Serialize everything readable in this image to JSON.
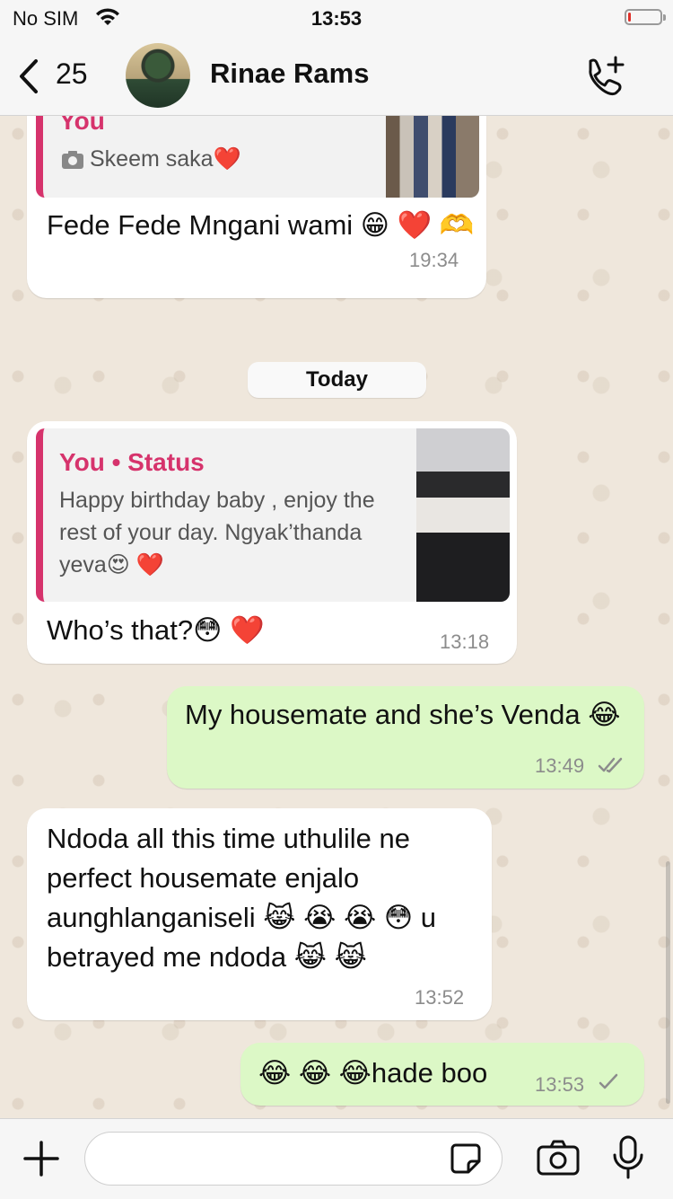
{
  "status_bar": {
    "carrier": "No SIM",
    "time": "13:53",
    "battery_level": 0.1,
    "battery_color": "#e0302a"
  },
  "header": {
    "back_count": "25",
    "contact_name": "Rinae Rams"
  },
  "colors": {
    "accent_quote": "#d6336c",
    "outgoing_bubble": "#dcf8c6",
    "incoming_bubble": "#ffffff",
    "read_ticks": "#53bdeb"
  },
  "messages": [
    {
      "direction": "in",
      "quote": {
        "author": "You",
        "icon": "camera-icon",
        "text": "Skeem saka❤️"
      },
      "text": "Fede Fede Mngani wami 😁 ❤️ 🫶",
      "time": "19:34"
    },
    {
      "type": "date",
      "label": "Today"
    },
    {
      "direction": "in",
      "quote": {
        "author": "You • Status",
        "text": "Happy birthday baby , enjoy the rest of your day. Ngyak’thanda yeva😍 ❤️"
      },
      "text": "Who’s that?😳 ❤️",
      "time": "13:18"
    },
    {
      "direction": "out",
      "text": "My housemate and she’s Venda 😂",
      "time": "13:49",
      "ticks": "double"
    },
    {
      "direction": "in",
      "text": "Ndoda all this time uthulile ne perfect housemate enjalo aunghlanganiseli 😹 😭 😭 😳 u betrayed me ndoda 😹 😹",
      "time": "13:52"
    },
    {
      "direction": "out",
      "text": "😂 😂 😂hade boo",
      "time": "13:53",
      "ticks": "single"
    }
  ],
  "composer": {
    "value": "",
    "placeholder": ""
  }
}
